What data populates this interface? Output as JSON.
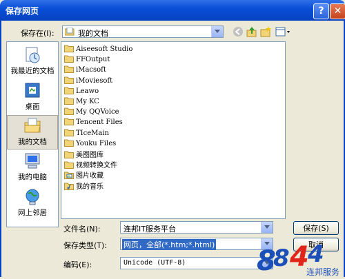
{
  "window": {
    "title": "保存网页"
  },
  "save_in": {
    "label": "保存在(I):",
    "value": "我的文档"
  },
  "places": [
    {
      "label": "我最近的文档",
      "icon": "recent-documents-icon"
    },
    {
      "label": "桌面",
      "icon": "desktop-icon"
    },
    {
      "label": "我的文档",
      "icon": "my-documents-icon",
      "selected": true
    },
    {
      "label": "我的电脑",
      "icon": "my-computer-icon"
    },
    {
      "label": "网上邻居",
      "icon": "network-places-icon"
    }
  ],
  "files": [
    {
      "name": "Aiseesoft Studio",
      "icon": "folder-icon"
    },
    {
      "name": "FFOutput",
      "icon": "folder-icon"
    },
    {
      "name": "iMacsoft",
      "icon": "folder-icon"
    },
    {
      "name": "iMoviesoft",
      "icon": "folder-icon"
    },
    {
      "name": "Leawo",
      "icon": "folder-icon"
    },
    {
      "name": "My KC",
      "icon": "folder-icon"
    },
    {
      "name": "My QQVoice",
      "icon": "folder-icon"
    },
    {
      "name": "Tencent Files",
      "icon": "folder-icon"
    },
    {
      "name": "TIceMain",
      "icon": "folder-icon"
    },
    {
      "name": "Youku Files",
      "icon": "folder-icon"
    },
    {
      "name": "美图图库",
      "icon": "folder-icon"
    },
    {
      "name": "视频转换文件",
      "icon": "folder-icon"
    },
    {
      "name": "图片收藏",
      "icon": "pictures-folder-icon"
    },
    {
      "name": "我的音乐",
      "icon": "music-folder-icon"
    }
  ],
  "filename": {
    "label": "文件名(N):",
    "value": "连邦IT服务平台"
  },
  "filetype": {
    "label": "保存类型(T):",
    "value": "网页，全部(*.htm;*.html)"
  },
  "encoding": {
    "label": "编码(E):",
    "value": "Unicode (UTF-8)"
  },
  "buttons": {
    "save": "保存(S)",
    "cancel": "取消"
  },
  "watermark": {
    "text": "连邦服务"
  },
  "colors": {
    "title_bar": "#0a4fd7",
    "selection": "#316ac5",
    "dialog_bg": "#ece9d8"
  }
}
